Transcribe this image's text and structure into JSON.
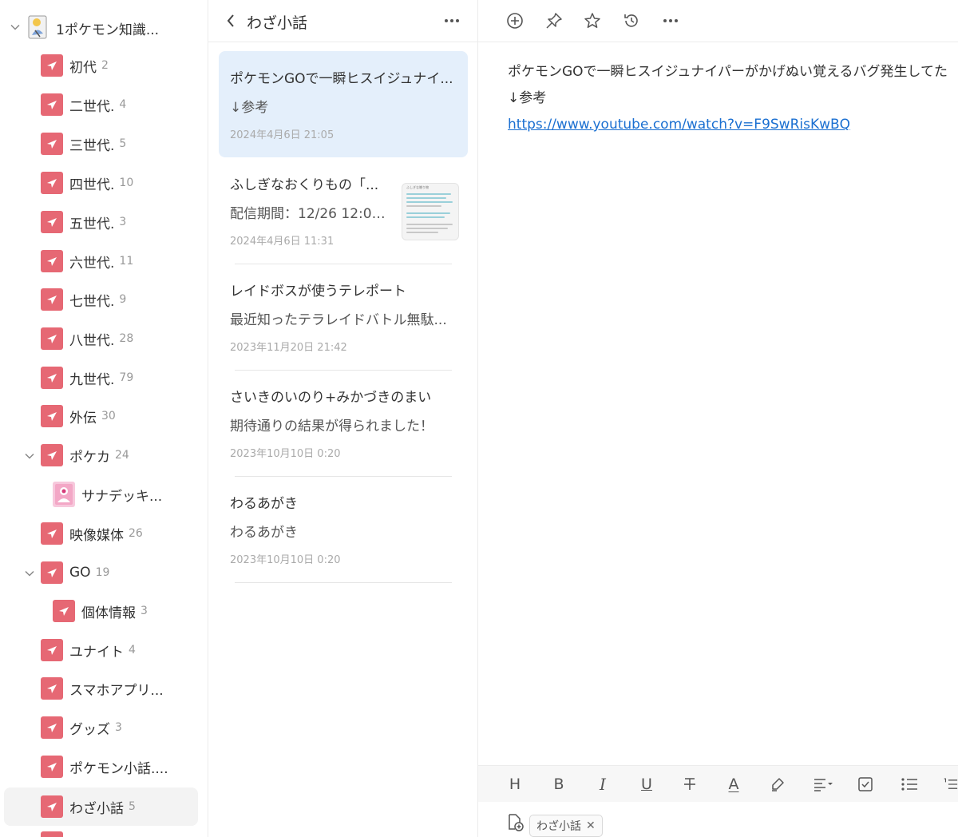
{
  "sidebar": {
    "root": {
      "label": "1ポケモン知識...",
      "expanded": true
    },
    "items": [
      {
        "label": "初代",
        "count": "2"
      },
      {
        "label": "二世代.",
        "count": "4"
      },
      {
        "label": "三世代.",
        "count": "5"
      },
      {
        "label": "四世代.",
        "count": "10"
      },
      {
        "label": "五世代.",
        "count": "3"
      },
      {
        "label": "六世代.",
        "count": "11"
      },
      {
        "label": "七世代.",
        "count": "9"
      },
      {
        "label": "八世代.",
        "count": "28"
      },
      {
        "label": "九世代.",
        "count": "79"
      },
      {
        "label": "外伝",
        "count": "30"
      },
      {
        "label": "ポケカ",
        "count": "24"
      },
      {
        "label": "サナデッキ...",
        "count": ""
      },
      {
        "label": "映像媒体",
        "count": "26"
      },
      {
        "label": "GO",
        "count": "19"
      },
      {
        "label": "個体情報",
        "count": "3"
      },
      {
        "label": "ユナイト",
        "count": "4"
      },
      {
        "label": "スマホアプリ...",
        "count": ""
      },
      {
        "label": "グッズ",
        "count": "3"
      },
      {
        "label": "ポケモン小話....",
        "count": ""
      },
      {
        "label": "わざ小話",
        "count": "5"
      }
    ],
    "selected": "わざ小話",
    "icon_color": "#e66874"
  },
  "notelist": {
    "title": "わざ小話",
    "notes": [
      {
        "title": "ポケモンGOで一瞬ヒスイジュナイ...",
        "preview": "↓参考",
        "date": "2024年4月6日 21:05"
      },
      {
        "title": "ふしぎなおくりもの「...",
        "preview": "配信期間：12/26 12:00...",
        "date": "2024年4月6日 11:31"
      },
      {
        "title": "レイドボスが使うテレポート",
        "preview": "最近知ったテラレイドバトル無駄...",
        "date": "2023年11月20日 21:42"
      },
      {
        "title": "さいきのいのり+みかづきのまい",
        "preview": "期待通りの結果が得られました！",
        "date": "2023年10月10日 0:20"
      },
      {
        "title": "わるあがき",
        "preview": "わるあがき",
        "date": "2023年10月10日 0:20"
      }
    ],
    "thumb_header": "ふしぎな贈り物",
    "selected_color": "#e4effb"
  },
  "editor": {
    "lines": [
      "ポケモンGOで一瞬ヒスイジュナイパーがかげぬい覚えるバグ発生してた",
      "↓参考"
    ],
    "link": "https://www.youtube.com/watch?v=F9SwRisKwBQ",
    "link_color": "#1a6fd1",
    "format": {
      "heading": "H",
      "bold": "B",
      "italic": "I",
      "underline": "U",
      "font_color": "A"
    },
    "tag": {
      "label": "わざ小話",
      "remove": "✕"
    }
  }
}
